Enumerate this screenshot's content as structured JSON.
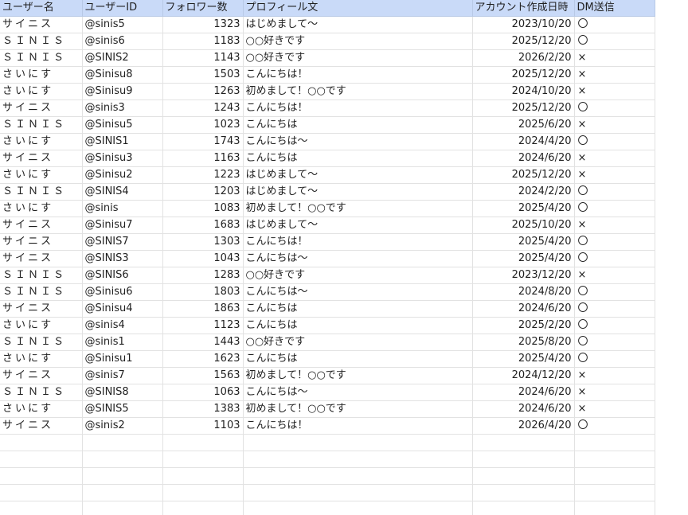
{
  "columns": [
    "ユーザー名",
    "ユーザーID",
    "フォロワー数",
    "プロフィール文",
    "アカウント作成日時",
    "DM送信"
  ],
  "rows": [
    [
      "サイニス",
      "@sinis5",
      "1323",
      "はじめまして〜",
      "2023/10/20",
      "〇"
    ],
    [
      "ＳＩＮＩＳ",
      "@sinis6",
      "1183",
      "○○好きです",
      "2025/12/20",
      "〇"
    ],
    [
      "ＳＩＮＩＳ",
      "@SINIS2",
      "1143",
      "○○好きです",
      "2026/2/20",
      "×"
    ],
    [
      "さいにす",
      "@Sinisu8",
      "1503",
      "こんにちは！",
      "2025/12/20",
      "×"
    ],
    [
      "さいにす",
      "@Sinisu9",
      "1263",
      "初めまして！○○です",
      "2024/10/20",
      "×"
    ],
    [
      "サイニス",
      "@sinis3",
      "1243",
      "こんにちは！",
      "2025/12/20",
      "〇"
    ],
    [
      "ＳＩＮＩＳ",
      "@Sinisu5",
      "1023",
      "こんにちは",
      "2025/6/20",
      "×"
    ],
    [
      "さいにす",
      "@SINIS1",
      "1743",
      "こんにちは〜",
      "2024/4/20",
      "〇"
    ],
    [
      "サイニス",
      "@Sinisu3",
      "1163",
      "こんにちは",
      "2024/6/20",
      "×"
    ],
    [
      "さいにす",
      "@Sinisu2",
      "1223",
      "はじめまして〜",
      "2025/12/20",
      "×"
    ],
    [
      "ＳＩＮＩＳ",
      "@SINIS4",
      "1203",
      "はじめまして〜",
      "2024/2/20",
      "〇"
    ],
    [
      "さいにす",
      "@sinis",
      "1083",
      "初めまして！○○です",
      "2025/4/20",
      "〇"
    ],
    [
      "サイニス",
      "@Sinisu7",
      "1683",
      "はじめまして〜",
      "2025/10/20",
      "×"
    ],
    [
      "サイニス",
      "@SINIS7",
      "1303",
      "こんにちは！",
      "2025/4/20",
      "〇"
    ],
    [
      "サイニス",
      "@SINIS3",
      "1043",
      "こんにちは〜",
      "2025/4/20",
      "〇"
    ],
    [
      "ＳＩＮＩＳ",
      "@SINIS6",
      "1283",
      "○○好きです",
      "2023/12/20",
      "×"
    ],
    [
      "ＳＩＮＩＳ",
      "@Sinisu6",
      "1803",
      "こんにちは〜",
      "2024/8/20",
      "〇"
    ],
    [
      "サイニス",
      "@Sinisu4",
      "1863",
      "こんにちは",
      "2024/6/20",
      "〇"
    ],
    [
      "さいにす",
      "@sinis4",
      "1123",
      "こんにちは",
      "2025/2/20",
      "〇"
    ],
    [
      "ＳＩＮＩＳ",
      "@sinis1",
      "1443",
      "○○好きです",
      "2025/8/20",
      "〇"
    ],
    [
      "さいにす",
      "@Sinisu1",
      "1623",
      "こんにちは",
      "2025/4/20",
      "〇"
    ],
    [
      "サイニス",
      "@sinis7",
      "1563",
      "初めまして！○○です",
      "2024/12/20",
      "×"
    ],
    [
      "ＳＩＮＩＳ",
      "@SINIS8",
      "1063",
      "こんにちは〜",
      "2024/6/20",
      "×"
    ],
    [
      "さいにす",
      "@SINIS5",
      "1383",
      "初めまして！○○です",
      "2024/6/20",
      "×"
    ],
    [
      "サイニス",
      "@sinis2",
      "1103",
      "こんにちは！",
      "2026/4/20",
      "〇"
    ]
  ],
  "colors": {
    "header_fill": "#c9daf8",
    "gridline": "#e2e2e2"
  }
}
